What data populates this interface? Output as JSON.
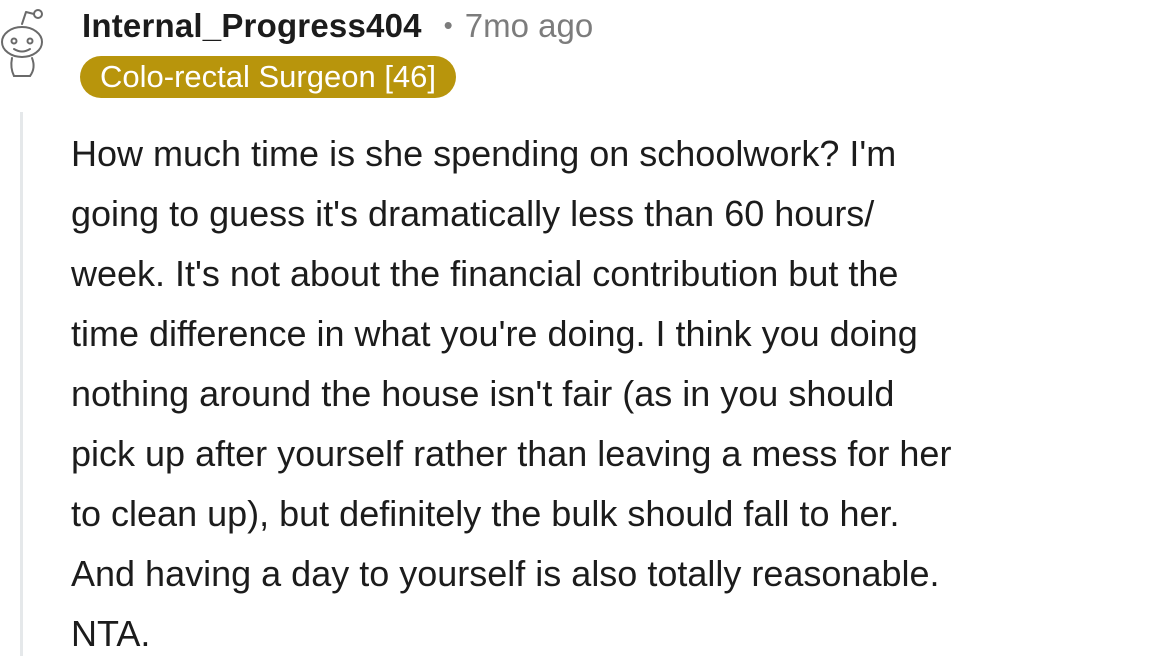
{
  "comment": {
    "username": "Internal_Progress404",
    "separator": "•",
    "timestamp": "7mo ago",
    "flair": "Colo-rectal Surgeon [46]",
    "avatar_icon": "snoo-avatar-icon",
    "flair_color": "#b8950c",
    "body_lines": [
      "How much time is she spending on schoolwork? I'm",
      "going to guess it's dramatically less than 60 hours/",
      "week. It's not about the financial contribution but the",
      "time difference in what you're doing. I think you doing",
      "nothing around the house isn't fair (as in you should",
      "pick up after yourself rather than leaving a mess for her",
      "to clean up), but definitely the bulk should fall to her.",
      "And having a day to yourself is also totally reasonable.",
      "NTA."
    ]
  }
}
